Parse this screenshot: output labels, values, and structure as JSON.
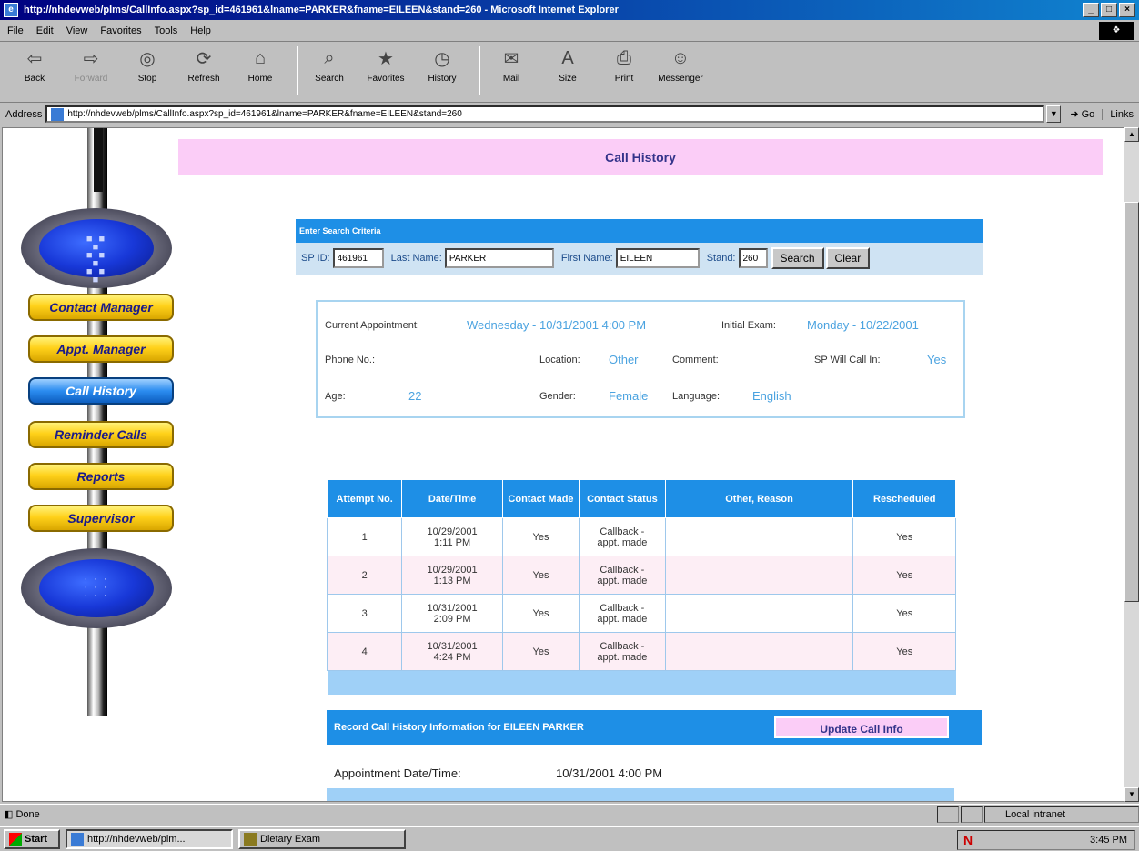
{
  "window": {
    "title": "http://nhdevweb/plms/CallInfo.aspx?sp_id=461961&lname=PARKER&fname=EILEEN&stand=260 - Microsoft Internet Explorer",
    "controls": [
      "_",
      "□",
      "×"
    ]
  },
  "menu": [
    "File",
    "Edit",
    "View",
    "Favorites",
    "Tools",
    "Help"
  ],
  "toolbar": [
    {
      "label": "Back",
      "icon": "back-arrow-icon",
      "glyph": "⇦"
    },
    {
      "label": "Forward",
      "icon": "forward-arrow-icon",
      "glyph": "⇨"
    },
    {
      "label": "Stop",
      "icon": "stop-icon",
      "glyph": "◎"
    },
    {
      "label": "Refresh",
      "icon": "refresh-icon",
      "glyph": "⟳"
    },
    {
      "label": "Home",
      "icon": "home-icon",
      "glyph": "⌂"
    },
    {
      "label": "Search",
      "icon": "search-icon",
      "glyph": "⌕"
    },
    {
      "label": "Favorites",
      "icon": "favorites-icon",
      "glyph": "★"
    },
    {
      "label": "History",
      "icon": "history-icon",
      "glyph": "◷"
    },
    {
      "label": "Mail",
      "icon": "mail-icon",
      "glyph": "✉"
    },
    {
      "label": "Size",
      "icon": "size-icon",
      "glyph": "A"
    },
    {
      "label": "Print",
      "icon": "print-icon",
      "glyph": "⎙"
    },
    {
      "label": "Messenger",
      "icon": "messenger-icon",
      "glyph": "☺"
    }
  ],
  "address": {
    "label": "Address",
    "url": "http://nhdevweb/plms/CallInfo.aspx?sp_id=461961&lname=PARKER&fname=EILEEN&stand=260",
    "go": "Go",
    "links": "Links"
  },
  "nav": {
    "items": [
      "Contact Manager",
      "Appt. Manager",
      "Call History",
      "Reminder Calls",
      "Reports",
      "Supervisor"
    ],
    "active": "Call History"
  },
  "page": {
    "title": "Call History"
  },
  "search": {
    "heading": "Enter Search Criteria",
    "sp_id_label": "SP ID:",
    "sp_id": "461961",
    "last_name_label": "Last Name:",
    "last_name": "PARKER",
    "first_name_label": "First Name:",
    "first_name": "EILEEN",
    "stand_label": "Stand:",
    "stand": "260",
    "search_button": "Search",
    "clear_button": "Clear"
  },
  "info": {
    "current_appt_label": "Current Appointment:",
    "current_appt": "Wednesday - 10/31/2001 4:00 PM",
    "initial_exam_label": "Initial Exam:",
    "initial_exam": "Monday - 10/22/2001",
    "phone_label": "Phone No.:",
    "phone": "",
    "location_label": "Location:",
    "location": "Other",
    "comment_label": "Comment:",
    "sp_will_call_label": "SP Will Call In:",
    "sp_will_call": "Yes",
    "age_label": "Age:",
    "age": "22",
    "gender_label": "Gender:",
    "gender": "Female",
    "language_label": "Language:",
    "language": "English"
  },
  "calls": {
    "headers": [
      "Attempt No.",
      "Date/Time",
      "Contact Made",
      "Contact Status",
      "Other, Reason",
      "Rescheduled"
    ],
    "rows": [
      {
        "attempt": "1",
        "date": "10/29/2001",
        "time": "1:11 PM",
        "made": "Yes",
        "status1": "Callback -",
        "status2": "appt. made",
        "reason": "",
        "rescheduled": "Yes"
      },
      {
        "attempt": "2",
        "date": "10/29/2001",
        "time": "1:13 PM",
        "made": "Yes",
        "status1": "Callback -",
        "status2": "appt. made",
        "reason": "",
        "rescheduled": "Yes"
      },
      {
        "attempt": "3",
        "date": "10/31/2001",
        "time": "2:09 PM",
        "made": "Yes",
        "status1": "Callback -",
        "status2": "appt. made",
        "reason": "",
        "rescheduled": "Yes"
      },
      {
        "attempt": "4",
        "date": "10/31/2001",
        "time": "4:24 PM",
        "made": "Yes",
        "status1": "Callback -",
        "status2": "appt. made",
        "reason": "",
        "rescheduled": "Yes"
      }
    ]
  },
  "record": {
    "label": "Record Call History Information for EILEEN PARKER",
    "update_button": "Update Call Info",
    "appt_label": "Appointment Date/Time:",
    "appt_value": "10/31/2001 4:00 PM"
  },
  "status": {
    "text": "Done",
    "zone": "Local intranet"
  },
  "taskbar": {
    "start": "Start",
    "tasks": [
      "http://nhdevweb/plm...",
      "Dietary Exam"
    ],
    "clock": "3:45 PM"
  },
  "colors": {
    "accent_blue": "#1e8fe6",
    "header_pink": "#fbcdf7",
    "value_blue": "#4ba3e0",
    "nav_gold": "#ffd11a"
  }
}
